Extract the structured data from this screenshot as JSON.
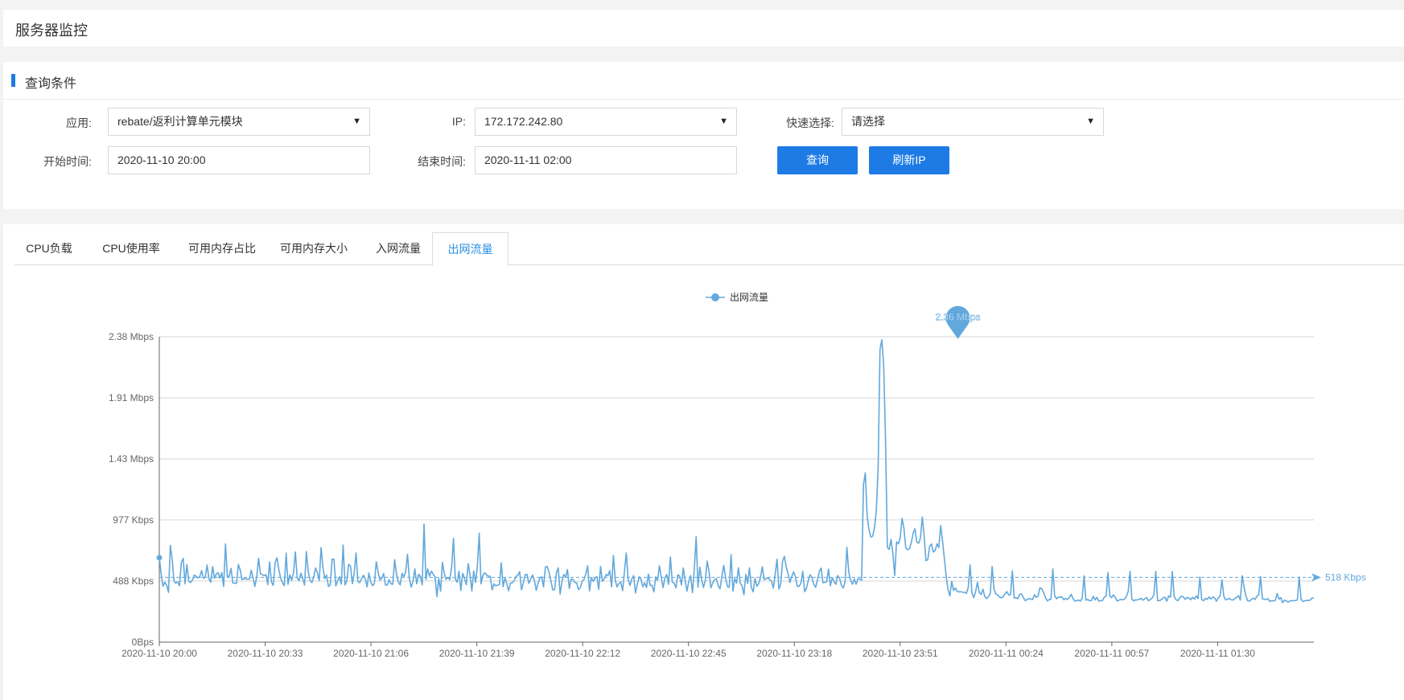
{
  "page": {
    "title": "服务器监控"
  },
  "query": {
    "section_title": "查询条件",
    "app_label": "应用:",
    "app_value": "rebate/返利计算单元模块",
    "ip_label": "IP:",
    "ip_value": "172.172.242.80",
    "quick_label": "快速选择:",
    "quick_value": "请选择",
    "start_label": "开始时间:",
    "start_value": "2020-11-10 20:00",
    "end_label": "结束时间:",
    "end_value": "2020-11-11 02:00",
    "search_button": "查询",
    "refresh_button": "刷新IP",
    "caret_icon": "▼"
  },
  "tabs": [
    {
      "label": "CPU负载"
    },
    {
      "label": "CPU使用率"
    },
    {
      "label": "可用内存占比"
    },
    {
      "label": "可用内存大小"
    },
    {
      "label": "入网流量"
    },
    {
      "label": "出网流量"
    }
  ],
  "colors": {
    "accent": "#1e7be6",
    "series": "#62a8dc",
    "tab_active": "#2d8fe3"
  },
  "chart_data": {
    "type": "line",
    "title": "",
    "series": [
      {
        "name": "出网流量",
        "unit": "Kbps"
      }
    ],
    "y_ticks": [
      "0Bps",
      "488 Kbps",
      "977 Kbps",
      "1.43 Mbps",
      "1.91 Mbps",
      "2.38 Mbps"
    ],
    "y_tick_values_kbps": [
      0,
      488,
      977,
      1465,
      1953,
      2441
    ],
    "ylim_kbps": [
      0,
      2441
    ],
    "x_ticks": [
      "2020-11-10 20:00",
      "2020-11-10 20:33",
      "2020-11-10 21:06",
      "2020-11-10 21:39",
      "2020-11-10 22:12",
      "2020-11-10 22:45",
      "2020-11-10 23:18",
      "2020-11-10 23:51",
      "2020-11-11 00:24",
      "2020-11-11 00:57",
      "2020-11-11 01:30"
    ],
    "x_range": [
      "2020-11-10 20:00",
      "2020-11-11 02:00"
    ],
    "max_label": "2.36 Mbps",
    "max_value_kbps": 2417,
    "max_time": "2020-11-11 00:09",
    "average_label": "518 Kbps",
    "average_value_kbps": 518,
    "values_kbps": [
      675,
      547,
      447,
      479,
      455,
      398,
      773,
      659,
      488,
      471,
      483,
      451,
      636,
      669,
      466,
      620,
      487,
      477,
      495,
      536,
      528,
      512,
      524,
      572,
      510,
      520,
      616,
      506,
      479,
      603,
      510,
      544,
      556,
      511,
      556,
      445,
      785,
      523,
      528,
      590,
      473,
      472,
      470,
      621,
      577,
      499,
      508,
      506,
      503,
      503,
      575,
      511,
      446,
      524,
      669,
      546,
      540,
      531,
      540,
      459,
      642,
      480,
      454,
      637,
      675,
      580,
      512,
      475,
      451,
      711,
      463,
      538,
      494,
      554,
      721,
      514,
      491,
      551,
      508,
      456,
      724,
      563,
      493,
      476,
      522,
      593,
      554,
      491,
      756,
      597,
      506,
      536,
      445,
      458,
      664,
      662,
      449,
      490,
      522,
      464,
      777,
      457,
      491,
      622,
      608,
      467,
      550,
      713,
      485,
      476,
      507,
      535,
      508,
      442,
      552,
      480,
      451,
      470,
      643,
      563,
      495,
      510,
      548,
      456,
      456,
      500,
      466,
      463,
      659,
      544,
      482,
      457,
      549,
      524,
      559,
      702,
      508,
      440,
      488,
      585,
      467,
      542,
      527,
      458,
      945,
      500,
      586,
      526,
      568,
      544,
      519,
      364,
      509,
      407,
      637,
      550,
      502,
      516,
      500,
      598,
      830,
      505,
      479,
      567,
      412,
      550,
      507,
      459,
      627,
      539,
      409,
      568,
      477,
      605,
      871,
      466,
      534,
      555,
      537,
      528,
      525,
      417,
      467,
      450,
      456,
      460,
      634,
      443,
      514,
      468,
      411,
      471,
      475,
      492,
      525,
      535,
      563,
      418,
      474,
      539,
      542,
      470,
      503,
      537,
      496,
      414,
      470,
      515,
      521,
      441,
      600,
      605,
      559,
      491,
      418,
      420,
      554,
      594,
      384,
      484,
      541,
      519,
      580,
      429,
      504,
      501,
      476,
      475,
      420,
      435,
      486,
      500,
      545,
      611,
      409,
      517,
      486,
      511,
      524,
      422,
      605,
      486,
      506,
      541,
      531,
      572,
      442,
      693,
      494,
      442,
      469,
      482,
      411,
      563,
      713,
      503,
      453,
      506,
      531,
      393,
      462,
      522,
      503,
      443,
      475,
      436,
      544,
      453,
      454,
      402,
      521,
      494,
      610,
      519,
      435,
      513,
      541,
      462,
      681,
      479,
      473,
      434,
      537,
      530,
      457,
      593,
      494,
      407,
      488,
      531,
      395,
      587,
      842,
      439,
      599,
      497,
      437,
      496,
      648,
      564,
      435,
      472,
      500,
      508,
      449,
      426,
      526,
      614,
      515,
      444,
      439,
      700,
      408,
      508,
      471,
      594,
      471,
      450,
      379,
      541,
      469,
      594,
      437,
      402,
      510,
      446,
      467,
      518,
      602,
      501,
      505,
      515,
      499,
      486,
      432,
      544,
      662,
      424,
      465,
      648,
      686,
      601,
      547,
      476,
      524,
      562,
      523,
      446,
      446,
      471,
      566,
      403,
      430,
      494,
      539,
      516,
      461,
      438,
      498,
      566,
      591,
      474,
      478,
      482,
      583,
      450,
      514,
      485,
      462,
      532,
      511,
      454,
      433,
      482,
      758,
      561,
      494,
      462,
      505,
      463,
      505,
      504,
      495,
      1257,
      1353,
      1006,
      900,
      841,
      847,
      914,
      1051,
      1401,
      2338,
      2417,
      2212,
      1625,
      758,
      741,
      821,
      708,
      532,
      801,
      786,
      834,
      989,
      911,
      754,
      738,
      747,
      794,
      869,
      906,
      801,
      790,
      832,
      1000,
      852,
      651,
      659,
      765,
      785,
      720,
      733,
      786,
      755,
      932,
      810,
      669,
      525,
      421,
      369,
      486,
      413,
      433,
      405,
      402,
      403,
      399,
      399,
      390,
      437,
      618,
      392,
      355,
      404,
      478,
      397,
      381,
      423,
      364,
      349,
      363,
      389,
      605,
      425,
      386,
      377,
      360,
      355,
      362,
      387,
      404,
      377,
      379,
      570,
      352,
      355,
      347,
      383,
      385,
      355,
      331,
      342,
      348,
      344,
      341,
      379,
      358,
      369,
      435,
      427,
      395,
      355,
      330,
      340,
      343,
      585,
      371,
      346,
      360,
      360,
      361,
      338,
      349,
      342,
      356,
      382,
      348,
      327,
      333,
      336,
      327,
      354,
      530,
      335,
      341,
      331,
      333,
      366,
      338,
      358,
      328,
      331,
      332,
      360,
      370,
      557,
      368,
      356,
      378,
      357,
      328,
      336,
      342,
      338,
      344,
      364,
      405,
      566,
      343,
      330,
      338,
      337,
      342,
      350,
      335,
      346,
      356,
      331,
      340,
      352,
      380,
      565,
      331,
      332,
      339,
      354,
      359,
      327,
      369,
      360,
      565,
      366,
      340,
      331,
      353,
      368,
      360,
      342,
      357,
      353,
      339,
      358,
      344,
      369,
      348,
      519,
      340,
      331,
      351,
      342,
      361,
      345,
      361,
      354,
      327,
      353,
      369,
      498,
      367,
      338,
      342,
      350,
      338,
      337,
      348,
      359,
      371,
      337,
      530,
      440,
      369,
      331,
      328,
      341,
      352,
      341,
      367,
      378,
      524,
      346,
      343,
      341,
      348,
      325,
      331,
      329,
      333,
      388,
      344,
      356,
      316,
      335,
      330,
      320,
      330,
      331,
      331,
      332,
      338,
      520,
      343,
      324,
      330,
      334,
      333,
      336,
      353,
      351
    ]
  }
}
